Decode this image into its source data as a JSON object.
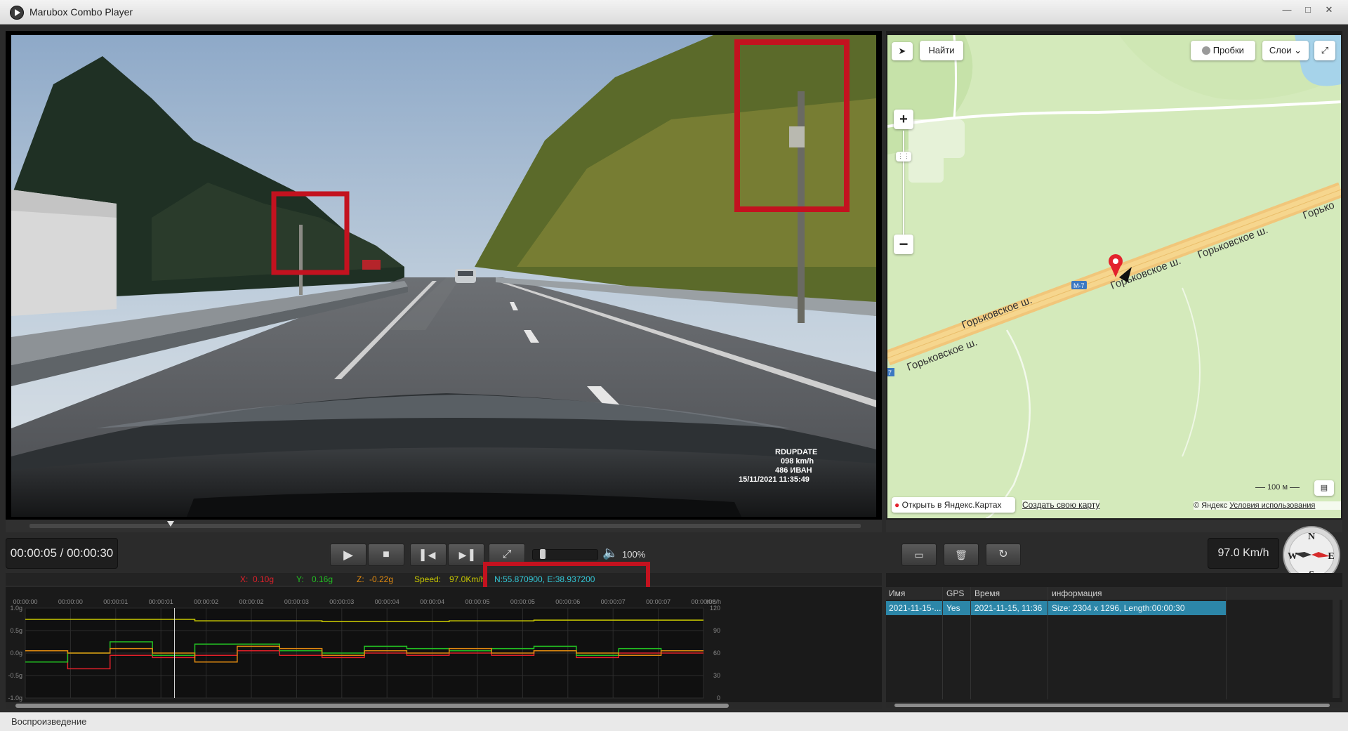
{
  "app": {
    "title": "Marubox Combo Player"
  },
  "window": {
    "minimize_icon": "minimize-icon",
    "maximize_icon": "maximize-icon",
    "close_icon": "close-icon"
  },
  "video_overlay": {
    "line1": "RDUPDATE",
    "line2": "098  km/h",
    "line3": "486  ИВАН",
    "line4": "15/11/2021  11:35:49"
  },
  "map": {
    "find_label": "Найти",
    "traffic_label": "Пробки",
    "layers_label": "Слои",
    "road_name": "Горьковское ш.",
    "road_name_partial": "Горько",
    "route_badge": "М-7",
    "route_badge_left": "7",
    "scale_label": "100 м",
    "open_in_label": "Открыть в Яндекс.Картах",
    "create_map_label": "Создать свою карту",
    "copyright": "© Яндекс",
    "terms_label": "Условия использования"
  },
  "playback": {
    "time": "00:00:05 / 00:00:30",
    "volume": "100%",
    "progress_fraction": 0.17,
    "volume_fraction": 0.12,
    "speed": "97.0 Km/h"
  },
  "compass": {
    "n": "N",
    "s": "S",
    "e": "E",
    "w": "W"
  },
  "sensors": {
    "x_label": "X:",
    "x_value": "0.10g",
    "y_label": "Y:",
    "y_value": "0.16g",
    "z_label": "Z:",
    "z_value": "-0.22g",
    "speed_label": "Speed:",
    "speed_value": "97.0Km/h",
    "coords": "N:55.870900, E:38.937200"
  },
  "chart_data": {
    "type": "line",
    "x": [
      "00:00:00",
      "00:00:00",
      "00:00:01",
      "00:00:01",
      "00:00:02",
      "00:00:02",
      "00:00:03",
      "00:00:03",
      "00:00:04",
      "00:00:04",
      "00:00:05",
      "00:00:05",
      "00:00:06",
      "00:00:07",
      "00:00:07",
      "00:00:08"
    ],
    "xlabel_right": "Km/h",
    "y_left_ticks": [
      "1.0g",
      "0.5g",
      "0.0g",
      "-0.5g",
      "-1.0g"
    ],
    "y_right_ticks": [
      "120",
      "90",
      "60",
      "30",
      "0"
    ],
    "ylim_left": [
      -1.0,
      1.0
    ],
    "ylim_right": [
      0,
      120
    ],
    "cursor_time": "00:00:05",
    "series": [
      {
        "color": "#c8c800",
        "axis": "right",
        "values": [
          105,
          105,
          105,
          105,
          103,
          103,
          103,
          102,
          102,
          102,
          103,
          103,
          104,
          104,
          104,
          104
        ]
      },
      {
        "color": "#e0202a",
        "axis": "left",
        "values": [
          0.05,
          -0.35,
          -0.05,
          -0.1,
          -0.05,
          0.05,
          -0.05,
          -0.1,
          0.0,
          -0.05,
          0.0,
          -0.05,
          0.05,
          -0.1,
          0.0,
          0.0
        ]
      },
      {
        "color": "#22c022",
        "axis": "left",
        "values": [
          -0.2,
          0.0,
          0.25,
          -0.05,
          0.2,
          0.2,
          0.05,
          0.0,
          0.15,
          0.1,
          0.05,
          0.1,
          0.15,
          -0.05,
          0.1,
          0.05
        ]
      },
      {
        "color": "#e08a10",
        "axis": "left",
        "values": [
          0.05,
          0.0,
          0.1,
          0.0,
          -0.2,
          0.15,
          0.1,
          -0.05,
          0.05,
          0.0,
          0.1,
          0.0,
          0.05,
          0.0,
          -0.05,
          0.05
        ]
      }
    ]
  },
  "file_list": {
    "columns": [
      "Имя",
      "GPS",
      "Время",
      "информация"
    ],
    "rows": [
      {
        "name": "2021-11-15-...",
        "gps": "Yes",
        "time": "2021-11-15, 11:36",
        "info": "Size: 2304 x 1296, Length:00:00:30"
      }
    ]
  },
  "status": {
    "text": "Воспроизведение"
  }
}
